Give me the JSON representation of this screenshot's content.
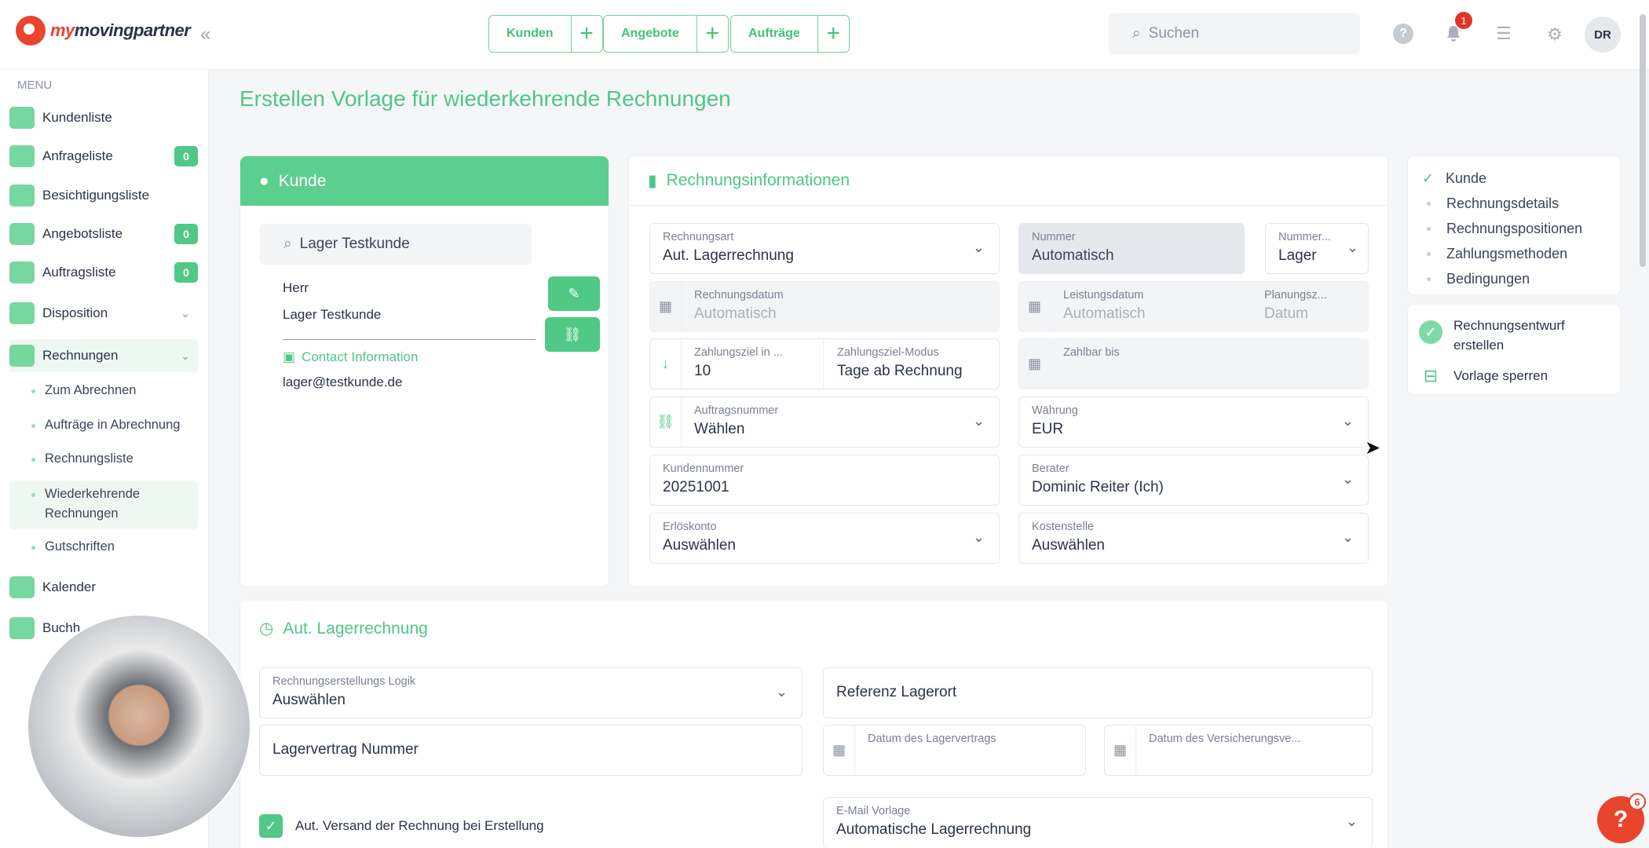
{
  "app": {
    "logo_prefix": "my",
    "logo_main": "moving",
    "logo_suffix": "partner"
  },
  "topnav": [
    {
      "label": "Kunden"
    },
    {
      "label": "Angebote"
    },
    {
      "label": "Aufträge"
    }
  ],
  "search": {
    "placeholder": "Suchen"
  },
  "notifications": {
    "count": "1"
  },
  "user": {
    "initials": "DR"
  },
  "sidebar": {
    "menu_title": "MENU",
    "items": [
      {
        "label": "Kundenliste"
      },
      {
        "label": "Anfrageliste",
        "count": "0"
      },
      {
        "label": "Besichtigungsliste"
      },
      {
        "label": "Angebotsliste",
        "count": "0"
      },
      {
        "label": "Auftragsliste",
        "count": "0"
      },
      {
        "label": "Disposition"
      },
      {
        "label": "Rechnungen"
      },
      {
        "label": "Kalender"
      },
      {
        "label": "Buchh"
      }
    ],
    "sub": [
      "Zum Abrechnen",
      "Aufträge in Abrechnung",
      "Rechnungsliste",
      "Wiederkehrende Rechnungen",
      "Gutschriften"
    ]
  },
  "page": {
    "title": "Erstellen Vorlage für wiederkehrende Rechnungen"
  },
  "kunde": {
    "header": "Kunde",
    "search_value": "Lager Testkunde",
    "salutation": "Herr",
    "name": "Lager Testkunde",
    "contact_header": "Contact Information",
    "email": "lager@testkunde.de"
  },
  "rechnung": {
    "header": "Rechnungsinformationen",
    "rechnungsart": {
      "label": "Rechnungsart",
      "value": "Aut. Lagerrechnung"
    },
    "nummer": {
      "label": "Nummer",
      "value": "Automatisch"
    },
    "nummerkreis": {
      "label": "Nummer...",
      "value": "Lager"
    },
    "rechnungsdatum": {
      "label": "Rechnungsdatum",
      "value": "Automatisch"
    },
    "leistungsdatum": {
      "label": "Leistungsdatum",
      "value": "Automatisch"
    },
    "planung": {
      "label": "Planungsz...",
      "value": "Datum"
    },
    "zahlungsziel": {
      "label": "Zahlungsziel in ...",
      "value": "10"
    },
    "zahlungsmodus": {
      "label": "Zahlungsziel-Modus",
      "value": "Tage ab Rechnung"
    },
    "zahlbar": {
      "label": "Zahlbar bis",
      "value": ""
    },
    "auftrag": {
      "label": "Auftragsnummer",
      "value": "Wählen"
    },
    "waehrung": {
      "label": "Währung",
      "value": "EUR"
    },
    "kundennummer": {
      "label": "Kundennummer",
      "value": "20251001"
    },
    "berater": {
      "label": "Berater",
      "value": "Dominic Reiter (Ich)"
    },
    "erloes": {
      "label": "Erlöskonto",
      "value": "Auswählen"
    },
    "kosten": {
      "label": "Kostenstelle",
      "value": "Auswählen"
    }
  },
  "steps": {
    "items": [
      "Kunde",
      "Rechnungsdetails",
      "Rechnungspositionen",
      "Zahlungsmethoden",
      "Bedingungen"
    ]
  },
  "actions": {
    "create_draft": "Rechnungsentwurf erstellen",
    "lock": "Vorlage sperren"
  },
  "lager": {
    "header": "Aut. Lagerrechnung",
    "logik": {
      "label": "Rechnungserstellungs Logik",
      "value": "Auswählen"
    },
    "referenz": "Referenz Lagerort",
    "vertrag_nr": "Lagervertrag Nummer",
    "datum_vertrag": "Datum des Lagervertrags",
    "datum_vers": "Datum des Versicherungsve...",
    "auto_send": "Aut. Versand der Rechnung bei Erstellung",
    "email": {
      "label": "E-Mail Vorlage",
      "value": "Automatische Lagerrechnung"
    }
  },
  "help": {
    "count": "6",
    "label": "?"
  }
}
